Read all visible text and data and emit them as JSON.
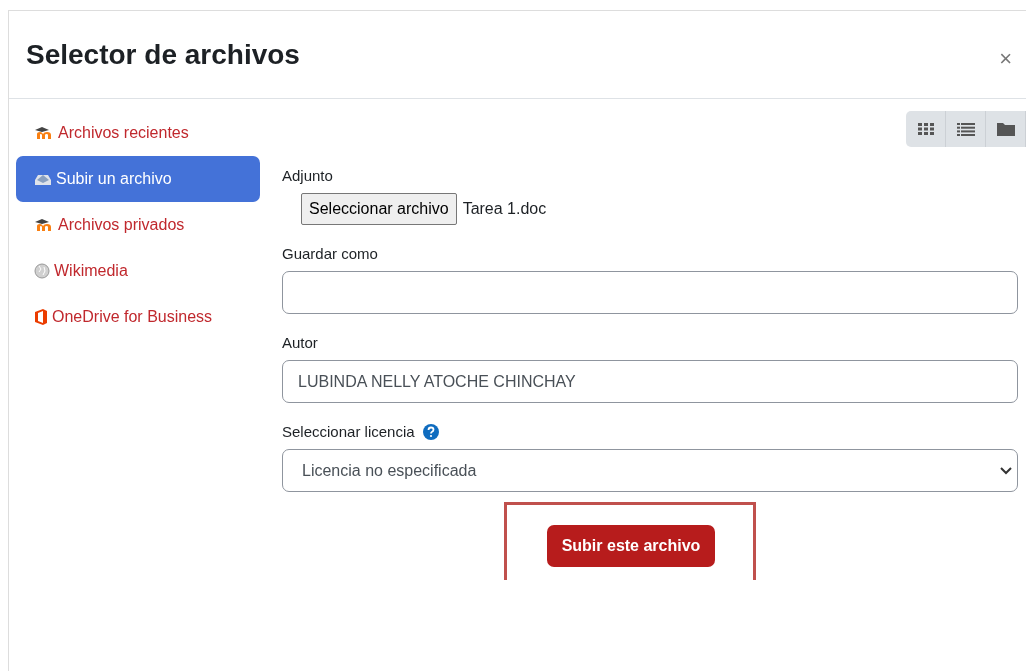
{
  "window": {
    "title": "Selector de archivos",
    "close": "×"
  },
  "sidebar": {
    "items": [
      {
        "label": "Archivos recientes",
        "kind": "moodle",
        "selected": false
      },
      {
        "label": "Subir un archivo",
        "kind": "upload",
        "selected": true
      },
      {
        "label": "Archivos privados",
        "kind": "moodle",
        "selected": false
      },
      {
        "label": "Wikimedia",
        "kind": "wiki",
        "selected": false
      },
      {
        "label": "OneDrive for Business",
        "kind": "office",
        "selected": false
      }
    ]
  },
  "view_buttons": [
    {
      "kind": "grid"
    },
    {
      "kind": "list"
    },
    {
      "kind": "folder"
    }
  ],
  "form": {
    "attachment": {
      "label": "Adjunto",
      "button": "Seleccionar archivo",
      "file": "Tarea 1.doc"
    },
    "save_as": {
      "label": "Guardar como"
    },
    "author": {
      "label": "Autor",
      "value": "LUBINDA NELLY ATOCHE CHINCHAY"
    },
    "license": {
      "label": "Seleccionar licencia",
      "value": "Licencia no especificada"
    },
    "submit": {
      "label": "Subir este archivo",
      "highlighted": true
    }
  }
}
